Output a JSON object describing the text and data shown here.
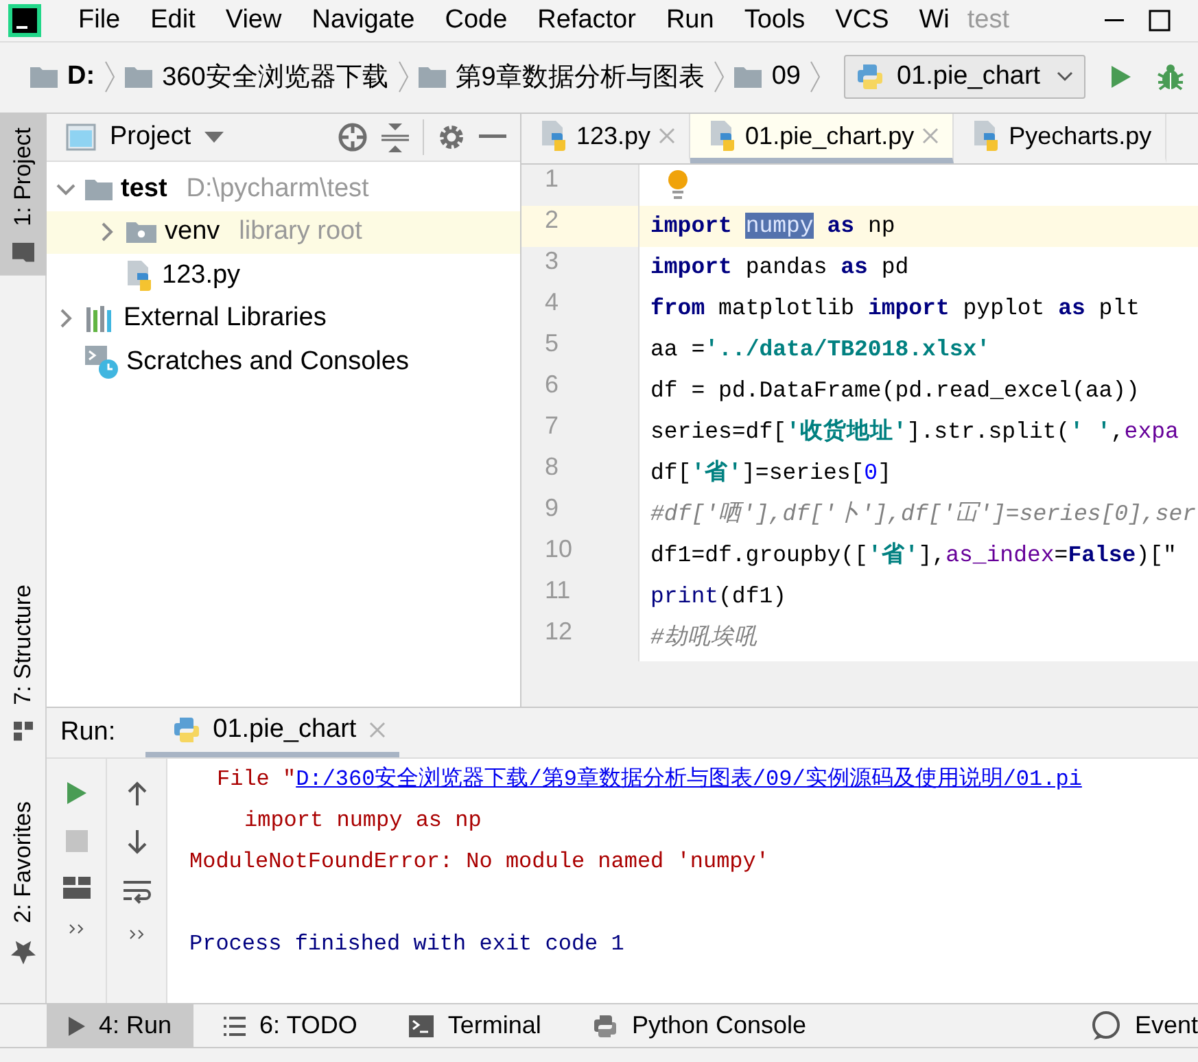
{
  "menu_bar": {
    "items": [
      "File",
      "Edit",
      "View",
      "Navigate",
      "Code",
      "Refactor",
      "Run",
      "Tools",
      "VCS",
      "Wi"
    ],
    "title": "test"
  },
  "breadcrumbs": [
    {
      "label": "D:",
      "kind": "drive"
    },
    {
      "label": "360安全浏览器下载",
      "kind": "folder"
    },
    {
      "label": "第9章数据分析与图表",
      "kind": "folder"
    },
    {
      "label": "09",
      "kind": "folder"
    }
  ],
  "run_config": {
    "label": "01.pie_chart"
  },
  "side_tabs_top": [
    {
      "label": "1: Project",
      "selected": true
    }
  ],
  "side_tabs_bottom": [
    {
      "label": "7: Structure",
      "selected": false
    },
    {
      "label": "2: Favorites",
      "selected": false
    }
  ],
  "project_panel": {
    "title": "Project",
    "tree": [
      {
        "label": "test",
        "detail": "D:\\pycharm\\test",
        "kind": "project",
        "expanded": true,
        "selected": false,
        "children": [
          {
            "label": "venv",
            "detail": "library root",
            "kind": "library-folder",
            "expanded": false,
            "selected": true
          },
          {
            "label": "123.py",
            "kind": "python-file",
            "selected": false
          }
        ]
      },
      {
        "label": "External Libraries",
        "kind": "libraries",
        "expanded": false,
        "selected": false
      },
      {
        "label": "Scratches and Consoles",
        "kind": "scratches",
        "selected": false
      }
    ]
  },
  "editor": {
    "tabs": [
      {
        "label": "123.py",
        "selected": false,
        "closable": true
      },
      {
        "label": "01.pie_chart.py",
        "selected": true,
        "closable": true
      },
      {
        "label": "Pyecharts.py",
        "selected": false,
        "closable": false
      }
    ],
    "lines": [
      {
        "number": "1",
        "current": false
      },
      {
        "number": "2",
        "current": true,
        "tokens": [
          {
            "text": "import ",
            "kind": "keyword"
          },
          {
            "text": "numpy",
            "kind": "selection"
          },
          {
            "text": " as",
            "kind": "keyword"
          },
          {
            "text": " np",
            "kind": "plain"
          }
        ]
      },
      {
        "number": "3",
        "current": false,
        "tokens": [
          {
            "text": "import",
            "kind": "keyword"
          },
          {
            "text": " pandas ",
            "kind": "plain"
          },
          {
            "text": "as",
            "kind": "keyword"
          },
          {
            "text": " pd",
            "kind": "plain"
          }
        ]
      },
      {
        "number": "4",
        "current": false,
        "tokens": [
          {
            "text": "from",
            "kind": "keyword"
          },
          {
            "text": " matplotlib ",
            "kind": "plain"
          },
          {
            "text": "import",
            "kind": "keyword"
          },
          {
            "text": " pyplot ",
            "kind": "plain"
          },
          {
            "text": "as",
            "kind": "keyword"
          },
          {
            "text": " plt",
            "kind": "plain"
          }
        ]
      },
      {
        "number": "5",
        "current": false,
        "tokens": [
          {
            "text": "aa =",
            "kind": "plain"
          },
          {
            "text": "'../data/TB2018.xlsx'",
            "kind": "string"
          }
        ]
      },
      {
        "number": "6",
        "current": false,
        "tokens": [
          {
            "text": "df = pd.DataFrame(pd.read_excel(aa))",
            "kind": "plain"
          }
        ]
      },
      {
        "number": "7",
        "current": false,
        "tokens": [
          {
            "text": "series=df[",
            "kind": "plain"
          },
          {
            "text": "'收货地址'",
            "kind": "string"
          },
          {
            "text": "].str.split(",
            "kind": "plain"
          },
          {
            "text": "' '",
            "kind": "string"
          },
          {
            "text": ",",
            "kind": "plain"
          },
          {
            "text": "expa",
            "kind": "parameter"
          }
        ]
      },
      {
        "number": "8",
        "current": false,
        "tokens": [
          {
            "text": "df[",
            "kind": "plain"
          },
          {
            "text": "'省'",
            "kind": "string"
          },
          {
            "text": "]=series[",
            "kind": "plain"
          },
          {
            "text": "0",
            "kind": "number"
          },
          {
            "text": "]",
            "kind": "plain"
          }
        ]
      },
      {
        "number": "9",
        "current": false,
        "tokens": [
          {
            "text": "#df['哂'],df['卜'],df['冚']=series[0],ser",
            "kind": "comment"
          }
        ]
      },
      {
        "number": "10",
        "current": false,
        "tokens": [
          {
            "text": "df1=df.groupby([",
            "kind": "plain"
          },
          {
            "text": "'省'",
            "kind": "string"
          },
          {
            "text": "],",
            "kind": "plain"
          },
          {
            "text": "as_index",
            "kind": "parameter"
          },
          {
            "text": "=",
            "kind": "plain"
          },
          {
            "text": "False",
            "kind": "keyword"
          },
          {
            "text": ")[\"",
            "kind": "plain"
          }
        ]
      },
      {
        "number": "11",
        "current": false,
        "tokens": [
          {
            "text": "print",
            "kind": "builtin"
          },
          {
            "text": "(df1)",
            "kind": "plain"
          }
        ]
      },
      {
        "number": "12",
        "current": false,
        "tokens": [
          {
            "text": "#劫吼埃吼",
            "kind": "comment"
          }
        ]
      }
    ]
  },
  "run_panel": {
    "title": "Run:",
    "tab": {
      "label": "01.pie_chart"
    },
    "console": [
      {
        "kind": "trace",
        "prefix": "File \"",
        "link": "D:/360安全浏览器下载/第9章数据分析与图表/09/实例源码及使用说明/01.pi"
      },
      {
        "kind": "source",
        "text": "import numpy as np"
      },
      {
        "kind": "error",
        "text": "ModuleNotFoundError: No module named 'numpy'"
      },
      {
        "kind": "blank"
      },
      {
        "kind": "info",
        "text": "Process finished with exit code 1"
      }
    ]
  },
  "bottom_tabs": [
    {
      "label": "4: Run",
      "selected": true,
      "kind": "run"
    },
    {
      "label": "6: TODO",
      "selected": false,
      "kind": "todo"
    },
    {
      "label": "Terminal",
      "selected": false,
      "kind": "terminal"
    },
    {
      "label": "Python Console",
      "selected": false,
      "kind": "python"
    },
    {
      "label": "Event",
      "selected": false,
      "kind": "event"
    }
  ]
}
